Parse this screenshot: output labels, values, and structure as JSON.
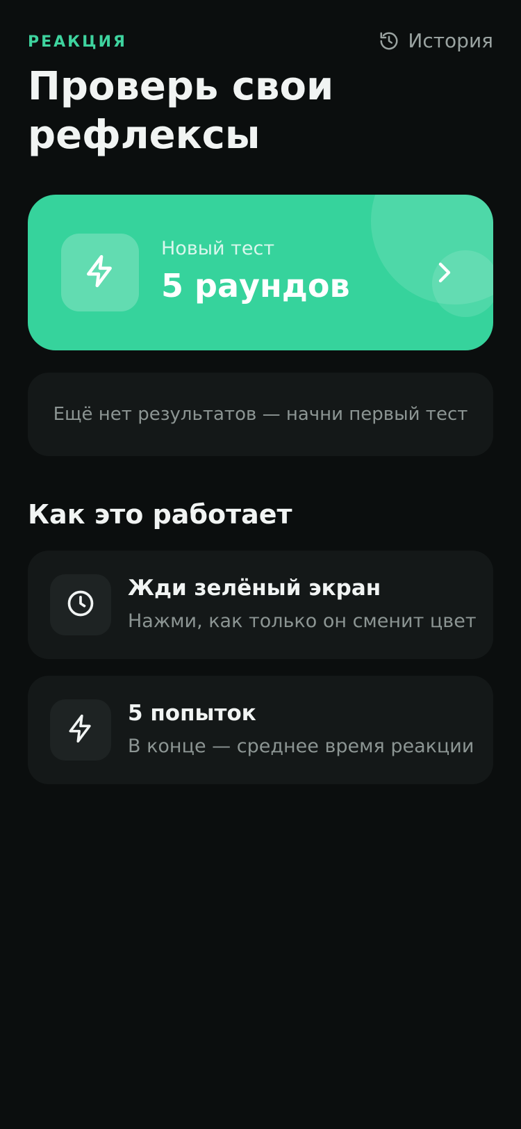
{
  "header": {
    "eyebrow": "РЕАКЦИЯ",
    "history_label": "История",
    "history_icon": "history-icon"
  },
  "title": "Проверь свои рефлексы",
  "start_card": {
    "subtitle": "Новый тест",
    "main": "5 раундов",
    "icon": "lightning-icon",
    "chevron_icon": "chevron-right-icon",
    "color": "#36d39c"
  },
  "empty_state": "Ещё нет результатов — начни первый тест",
  "how_it_works": {
    "title": "Как это работает",
    "steps": [
      {
        "icon": "clock-icon",
        "title": "Жди зелёный экран",
        "description": "Нажми, как только он сменит цвет"
      },
      {
        "icon": "lightning-icon",
        "title": "5 попыток",
        "description": "В конце — среднее время реакции"
      }
    ]
  },
  "colors": {
    "background": "#0b0e0e",
    "accent": "#3ed39e",
    "card": "#141818",
    "muted_text": "#8c9593"
  }
}
